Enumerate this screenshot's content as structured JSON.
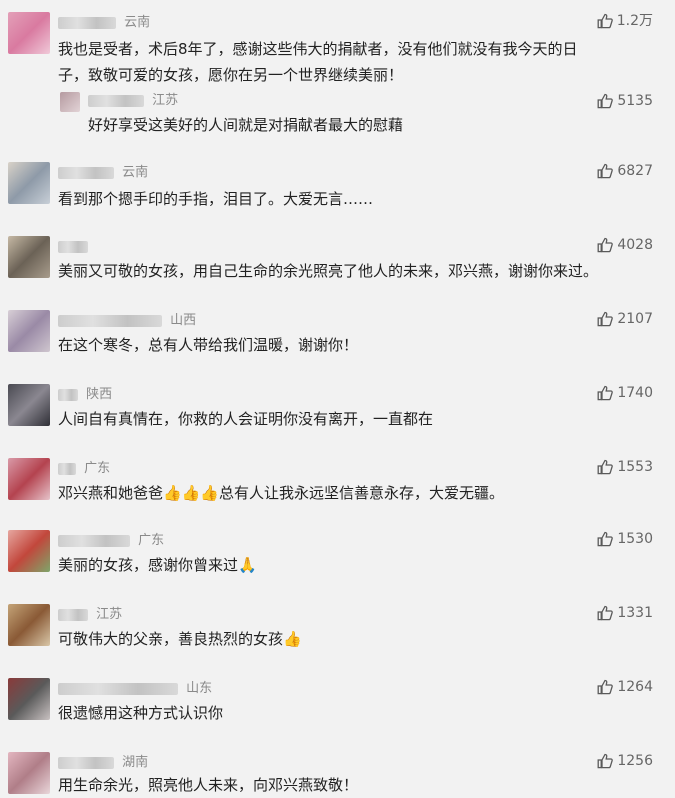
{
  "comments": [
    {
      "location": "云南",
      "text_line1": "我也是受者，术后8年了，感谢这些伟大的捐献者，没有他们就没有我今天的日",
      "text_line2": "子，致敬可爱的女孩，愿你在另一个世界继续美丽！",
      "likes": "1.2万",
      "reply": {
        "location": "江苏",
        "text": "好好享受这美好的人间就是对捐献者最大的慰藉",
        "likes": "5135"
      }
    },
    {
      "location": "云南",
      "text": "看到那个摁手印的手指，泪目了。大爱无言……",
      "likes": "6827"
    },
    {
      "location": "",
      "text": "美丽又可敬的女孩，用自己生命的余光照亮了他人的未来，邓兴燕，谢谢你来过。",
      "likes": "4028"
    },
    {
      "location": "山西",
      "text": "在这个寒冬，总有人带给我们温暖，谢谢你！",
      "likes": "2107"
    },
    {
      "location": "陕西",
      "text": "人间自有真情在，你救的人会证明你没有离开，一直都在",
      "likes": "1740"
    },
    {
      "location": "广东",
      "text": "邓兴燕和她爸爸👍👍👍总有人让我永远坚信善意永存，大爱无疆。",
      "likes": "1553"
    },
    {
      "location": "广东",
      "text": "美丽的女孩，感谢你曾来过🙏",
      "likes": "1530"
    },
    {
      "location": "江苏",
      "text": "可敬伟大的父亲，善良热烈的女孩👍",
      "likes": "1331"
    },
    {
      "location": "山东",
      "text": "很遗憾用这种方式认识你",
      "likes": "1264"
    },
    {
      "location": "湖南",
      "text": "用生命余光，照亮他人未来，向邓兴燕致敬！",
      "likes": "1256"
    }
  ]
}
